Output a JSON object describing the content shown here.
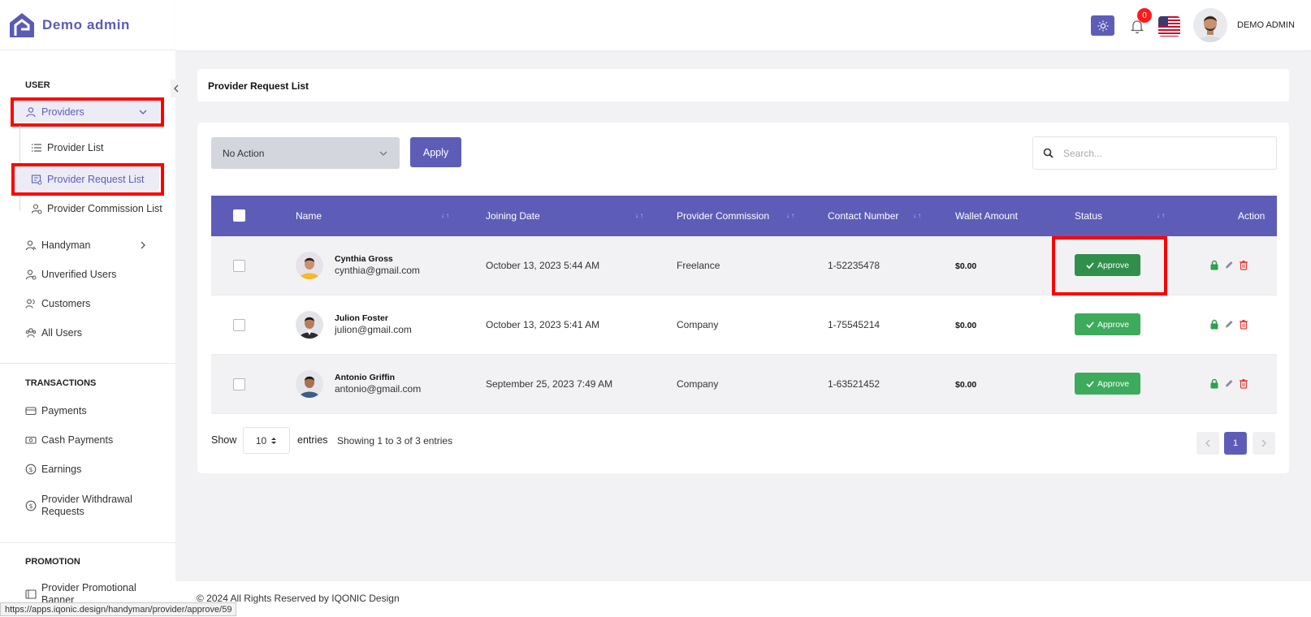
{
  "brand": {
    "name": "Demo admin"
  },
  "header": {
    "notification_count": "0",
    "user_name": "DEMO ADMIN"
  },
  "sidebar": {
    "sections": {
      "user": "USER",
      "transactions": "TRANSACTIONS",
      "promotion": "PROMOTION"
    },
    "providers": "Providers",
    "provider_list": "Provider List",
    "provider_request_list": "Provider Request List",
    "provider_commission_list": "Provider Commission List",
    "handyman": "Handyman",
    "unverified_users": "Unverified Users",
    "customers": "Customers",
    "all_users": "All Users",
    "payments": "Payments",
    "cash_payments": "Cash Payments",
    "earnings": "Earnings",
    "withdrawal_line1": "Provider Withdrawal",
    "withdrawal_line2": "Requests",
    "promo_line1": "Provider Promotional",
    "promo_line2": "Banner"
  },
  "page": {
    "title": "Provider Request List"
  },
  "toolbar": {
    "bulk_action": "No Action",
    "apply": "Apply",
    "search_placeholder": "Search..."
  },
  "table": {
    "headers": {
      "name": "Name",
      "joining_date": "Joining Date",
      "commission": "Provider Commission",
      "contact": "Contact Number",
      "wallet": "Wallet Amount",
      "status": "Status",
      "action": "Action"
    },
    "rows": [
      {
        "name": "Cynthia Gross",
        "email": "cynthia@gmail.com",
        "date": "October 13, 2023 5:44 AM",
        "commission": "Freelance",
        "contact": "1-52235478",
        "wallet": "$0.00",
        "status": "Approve"
      },
      {
        "name": "Julion Foster",
        "email": "julion@gmail.com",
        "date": "October 13, 2023 5:41 AM",
        "commission": "Company",
        "contact": "1-75545214",
        "wallet": "$0.00",
        "status": "Approve"
      },
      {
        "name": "Antonio Griffin",
        "email": "antonio@gmail.com",
        "date": "September 25, 2023 7:49 AM",
        "commission": "Company",
        "contact": "1-63521452",
        "wallet": "$0.00",
        "status": "Approve"
      }
    ]
  },
  "pagination": {
    "show": "Show",
    "page_length": "10",
    "entries": "entries",
    "info": "Showing 1 to 3 of 3 entries",
    "current_page": "1"
  },
  "footer": {
    "copyright": "© 2024 All Rights Reserved by IQONIC Design"
  },
  "statusbar": {
    "url": "https://apps.iqonic.design/handyman/provider/approve/59"
  },
  "colors": {
    "primary": "#5d5db8",
    "approve": "#3cab5b",
    "highlight": "#ff0000",
    "lock": "#2fa04c",
    "delete": "#e53935"
  }
}
